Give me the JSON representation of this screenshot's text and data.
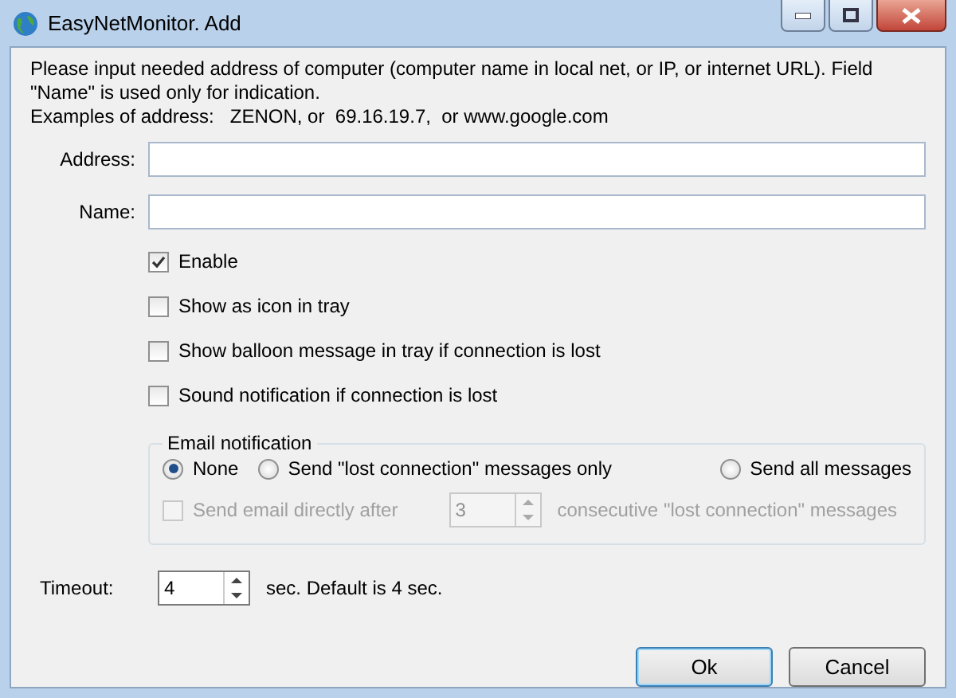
{
  "window": {
    "title": "EasyNetMonitor. Add"
  },
  "intro": [
    "Please input needed address of computer (computer name in local net, or IP, or internet URL). Field \"Name\" is used only for indication.",
    "Examples of address:   ZENON, or  69.16.19.7,  or www.google.com"
  ],
  "fields": [
    {
      "label": "Address:"
    },
    {
      "label": "Name:"
    }
  ],
  "checkboxes": [
    {
      "label": "Enable",
      "checked": true
    },
    {
      "label": "Show as icon in tray",
      "checked": false
    },
    {
      "label": "Show balloon message in tray if connection is lost",
      "checked": false
    },
    {
      "label": "Sound notification if connection is lost",
      "checked": false
    }
  ],
  "email": {
    "title": "Email notification",
    "options": [
      {
        "label": "None",
        "selected": true
      },
      {
        "label": "Send \"lost connection\" messages only",
        "selected": false
      },
      {
        "label": "Send all messages",
        "selected": false
      }
    ],
    "direct": {
      "label": "Send email directly after",
      "checked": false,
      "disabled": true,
      "count": "3",
      "suffix": "consecutive \"lost connection\" messages"
    }
  },
  "timeout": {
    "label": "Timeout:",
    "value": "4",
    "note": "sec. Default is 4 sec."
  },
  "buttons": [
    {
      "label": "Ok",
      "default": true
    },
    {
      "label": "Cancel",
      "default": false
    }
  ]
}
